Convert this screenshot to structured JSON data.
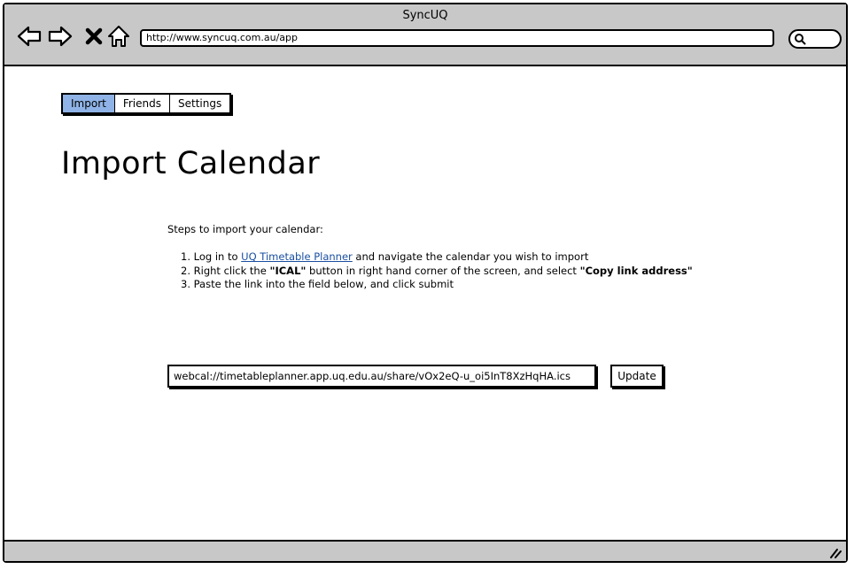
{
  "window": {
    "title": "SyncUQ"
  },
  "browser": {
    "url": "http://www.syncuq.com.au/app",
    "back_icon": "back-arrow-icon",
    "forward_icon": "forward-arrow-icon",
    "stop_icon": "close-icon",
    "home_icon": "home-icon",
    "search_icon": "search-icon"
  },
  "tabs": [
    {
      "label": "Import",
      "active": true
    },
    {
      "label": "Friends",
      "active": false
    },
    {
      "label": "Settings",
      "active": false
    }
  ],
  "page": {
    "title": "Import Calendar",
    "steps_intro": "Steps to import your calendar:",
    "steps": [
      {
        "prefix": "1. Log in to ",
        "link": "UQ Timetable Planner",
        "suffix": " and navigate the calendar you wish to import"
      },
      {
        "prefix": "2. Right click the ",
        "bold1": "\"ICAL\"",
        "middle": " button in right hand corner of the screen, and select ",
        "bold2": "\"Copy link address\""
      },
      {
        "text": "3. Paste the link into the field below, and click submit"
      }
    ]
  },
  "form": {
    "ical_url_value": "webcal://timetableplanner.app.uq.edu.au/share/vOx2eQ-u_oi5InT8XzHqHA.ics",
    "update_label": "Update"
  },
  "colors": {
    "chrome": "#c8c8c8",
    "active_tab": "#8fb3e6",
    "link": "#1a4fa0"
  }
}
